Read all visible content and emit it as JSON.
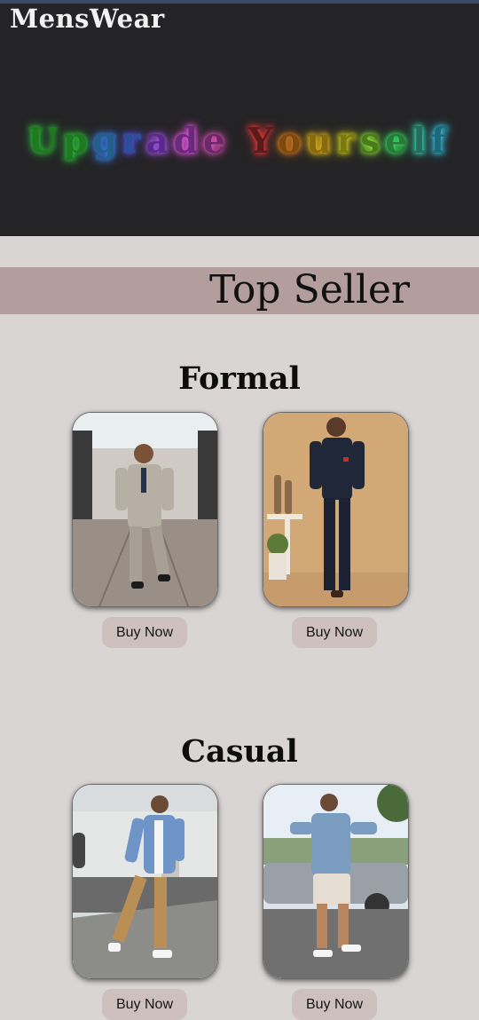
{
  "header": {
    "brand": "MensWear",
    "tagline_letters": [
      "U",
      "p",
      "g",
      "r",
      "a",
      "d",
      "e",
      " ",
      "Y",
      "o",
      "u",
      "r",
      "s",
      "e",
      "l",
      "f"
    ],
    "tagline_colors": [
      "#1f7a1f",
      "#1f7a1f",
      "#245f8a",
      "#2a4f9a",
      "#5a2a8a",
      "#6a2a7a",
      "#6a2a6a",
      "",
      "#5a1a1a",
      "#7a4a10",
      "#8a6a10",
      "#7a7a10",
      "#4a7a1a",
      "#2a7a3a",
      "#2a6a5a",
      "#1a6a7a"
    ],
    "tagline_glow": [
      "#2ecc40",
      "#2ecc40",
      "#3b82f6",
      "#5b5bff",
      "#b15bff",
      "#ff5bff",
      "#ff5bd0",
      "",
      "#ff3b3b",
      "#ff8c1a",
      "#ffd21a",
      "#f0f01a",
      "#9aff3b",
      "#3bff6b",
      "#3bffd0",
      "#3bd8ff"
    ]
  },
  "top_seller": {
    "title": "Top Seller"
  },
  "sections": [
    {
      "title": "Formal",
      "products": [
        {
          "image": "man-in-beige-three-piece-suit",
          "button": "Buy Now"
        },
        {
          "image": "man-in-navy-bandhgala-suit",
          "button": "Buy Now"
        }
      ]
    },
    {
      "title": "Casual",
      "products": [
        {
          "image": "man-in-denim-jacket-and-khakis",
          "button": "Buy Now"
        },
        {
          "image": "man-in-denim-shirt-and-shorts",
          "button": "Buy Now"
        }
      ]
    }
  ]
}
